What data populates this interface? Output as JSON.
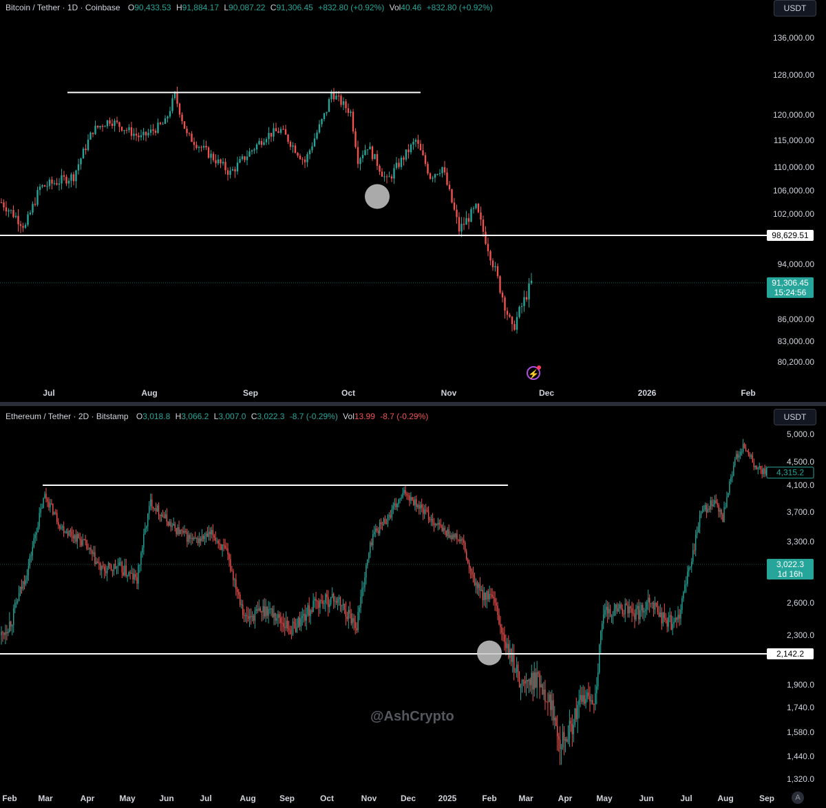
{
  "btc": {
    "legend": {
      "name": "Bitcoin / Tether · 1D · Coinbase",
      "o_label": "O",
      "o": "90,433.53",
      "h_label": "H",
      "h": "91,884.17",
      "l_label": "L",
      "l": "90,087.22",
      "c_label": "C",
      "c": "91,306.45",
      "change": "+832.80 (+0.92%)",
      "vol_label": "Vol",
      "vol": "40.46",
      "vol_change": "+832.80 (+0.92%)"
    },
    "currency_button": "USDT",
    "price_tag": "98,629.51",
    "last_price": "91,306.45",
    "countdown": "15:24:56"
  },
  "eth": {
    "legend": {
      "name": "Ethereum / Tether · 2D · Bitstamp",
      "o_label": "O",
      "o": "3,018.8",
      "h_label": "H",
      "h": "3,066.2",
      "l_label": "L",
      "l": "3,007.0",
      "c_label": "C",
      "c": "3,022.3",
      "change": "-8.7 (-0.29%)",
      "vol_label": "Vol",
      "vol": "13.99",
      "vol_change": "-8.7 (-0.29%)"
    },
    "currency_button": "USDT",
    "price_tag": "2,142.2",
    "price_tag_high": "4,315.2",
    "last_price": "3,022.3",
    "countdown": "1d 16h"
  },
  "watermark": "@AshCrypto",
  "a_button": "A",
  "colors": {
    "up": "#26a69a",
    "down": "#ef5350",
    "line": "#ffffff",
    "marker": "#c8c8c8",
    "last_tag": "#26a69a"
  },
  "chart_data": [
    {
      "type": "candlestick",
      "title": "Bitcoin / Tether · 1D · Coinbase",
      "y_ticks": [
        136000,
        128000,
        120000,
        115000,
        110000,
        106000,
        102000,
        94000,
        86000,
        83000,
        80200
      ],
      "y_tick_labels": [
        "136,000.00",
        "128,000.00",
        "120,000.00",
        "115,000.00",
        "110,000.00",
        "106,000.00",
        "102,000.00",
        "94,000.00",
        "86,000.00",
        "83,000.00",
        "80,200.00"
      ],
      "x_tick_labels": [
        "Jul",
        "Aug",
        "Sep",
        "Oct",
        "Nov",
        "Dec",
        "2026",
        "Feb"
      ],
      "resistance": 124500,
      "support": 98629.51,
      "last": 91306.45,
      "marker_close": 105000,
      "series": [
        {
          "t": 0,
          "c": 104000
        },
        {
          "t": 10,
          "c": 100000
        },
        {
          "t": 16,
          "c": 106500
        },
        {
          "t": 30,
          "c": 108500
        },
        {
          "t": 38,
          "c": 117000
        },
        {
          "t": 45,
          "c": 119000
        },
        {
          "t": 58,
          "c": 115500
        },
        {
          "t": 68,
          "c": 118500
        },
        {
          "t": 72,
          "c": 124000
        },
        {
          "t": 77,
          "c": 116000
        },
        {
          "t": 86,
          "c": 112500
        },
        {
          "t": 95,
          "c": 109000
        },
        {
          "t": 110,
          "c": 116000
        },
        {
          "t": 116,
          "c": 117000
        },
        {
          "t": 126,
          "c": 111000
        },
        {
          "t": 135,
          "c": 121000
        },
        {
          "t": 137,
          "c": 124500
        },
        {
          "t": 145,
          "c": 120500
        },
        {
          "t": 148,
          "c": 111500
        },
        {
          "t": 152,
          "c": 114000
        },
        {
          "t": 160,
          "c": 107500
        },
        {
          "t": 172,
          "c": 115000
        },
        {
          "t": 178,
          "c": 108500
        },
        {
          "t": 183,
          "c": 110000
        },
        {
          "t": 190,
          "c": 99500
        },
        {
          "t": 197,
          "c": 103000
        },
        {
          "t": 205,
          "c": 93000
        },
        {
          "t": 212,
          "c": 84500
        },
        {
          "t": 220,
          "c": 91306.45
        }
      ]
    },
    {
      "type": "candlestick",
      "title": "Ethereum / Tether · 2D · Bitstamp",
      "y_ticks": [
        5000,
        4500,
        4100,
        3700,
        3300,
        2600,
        2300,
        1900,
        1740,
        1580,
        1440,
        1320
      ],
      "y_tick_labels": [
        "5,000.0",
        "4,500.0",
        "4,100.0",
        "3,700.0",
        "3,300.0",
        "2,600.0",
        "2,300.0",
        "1,900.0",
        "1,740.0",
        "1,580.0",
        "1,440.0",
        "1,320.0"
      ],
      "x_tick_labels": [
        "Feb",
        "Mar",
        "Apr",
        "May",
        "Jun",
        "Jul",
        "Aug",
        "Sep",
        "Oct",
        "Nov",
        "Dec",
        "2025",
        "Feb",
        "Mar",
        "Apr",
        "May",
        "Jun",
        "Jul",
        "Aug",
        "Sep"
      ],
      "resistance": 4100,
      "support": 2142.2,
      "last": 3022.3,
      "marker_close": 2150,
      "series": [
        {
          "t": 0,
          "c": 2300
        },
        {
          "t": 8,
          "c": 2450
        },
        {
          "t": 20,
          "c": 3000
        },
        {
          "t": 32,
          "c": 3950
        },
        {
          "t": 44,
          "c": 3500
        },
        {
          "t": 60,
          "c": 3300
        },
        {
          "t": 74,
          "c": 2950
        },
        {
          "t": 86,
          "c": 3000
        },
        {
          "t": 100,
          "c": 2850
        },
        {
          "t": 110,
          "c": 3850
        },
        {
          "t": 126,
          "c": 3500
        },
        {
          "t": 142,
          "c": 3300
        },
        {
          "t": 156,
          "c": 3400
        },
        {
          "t": 166,
          "c": 3150
        },
        {
          "t": 180,
          "c": 2450
        },
        {
          "t": 196,
          "c": 2550
        },
        {
          "t": 214,
          "c": 2350
        },
        {
          "t": 232,
          "c": 2600
        },
        {
          "t": 246,
          "c": 2650
        },
        {
          "t": 262,
          "c": 2400
        },
        {
          "t": 274,
          "c": 3400
        },
        {
          "t": 286,
          "c": 3650
        },
        {
          "t": 298,
          "c": 4000
        },
        {
          "t": 312,
          "c": 3700
        },
        {
          "t": 326,
          "c": 3450
        },
        {
          "t": 340,
          "c": 3300
        },
        {
          "t": 346,
          "c": 2900
        },
        {
          "t": 354,
          "c": 2700
        },
        {
          "t": 362,
          "c": 2650
        },
        {
          "t": 372,
          "c": 2200
        },
        {
          "t": 384,
          "c": 1900
        },
        {
          "t": 396,
          "c": 1950
        },
        {
          "t": 406,
          "c": 1750
        },
        {
          "t": 412,
          "c": 1550
        },
        {
          "t": 420,
          "c": 1600
        },
        {
          "t": 428,
          "c": 1800
        },
        {
          "t": 438,
          "c": 1820
        },
        {
          "t": 444,
          "c": 2500
        },
        {
          "t": 456,
          "c": 2550
        },
        {
          "t": 470,
          "c": 2500
        },
        {
          "t": 478,
          "c": 2650
        },
        {
          "t": 488,
          "c": 2450
        },
        {
          "t": 498,
          "c": 2400
        },
        {
          "t": 508,
          "c": 3000
        },
        {
          "t": 516,
          "c": 3700
        },
        {
          "t": 526,
          "c": 3850
        },
        {
          "t": 532,
          "c": 3600
        },
        {
          "t": 542,
          "c": 4600
        },
        {
          "t": 548,
          "c": 4800
        },
        {
          "t": 556,
          "c": 4400
        },
        {
          "t": 564,
          "c": 4315.2
        }
      ]
    }
  ]
}
